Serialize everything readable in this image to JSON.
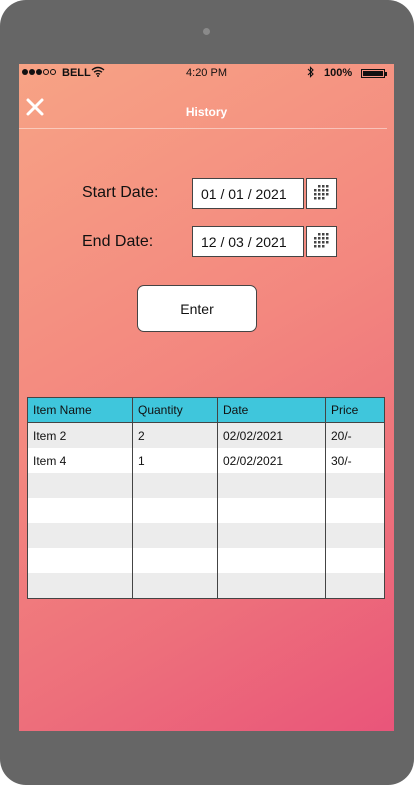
{
  "status_bar": {
    "carrier": "BELL",
    "time": "4:20 PM",
    "battery_percent": "100%",
    "battery_level": 1.0
  },
  "header": {
    "title": "History",
    "close_icon": "close-icon"
  },
  "form": {
    "start_label": "Start Date:",
    "start_value": "01 / 01 / 2021",
    "end_label": "End Date:",
    "end_value": "12 / 03 / 2021",
    "calendar_icon": "calendar-icon",
    "enter_label": "Enter"
  },
  "table": {
    "columns": [
      "Item Name",
      "Quantity",
      "Date",
      "Price"
    ],
    "rows": [
      [
        "Item 2",
        "2",
        "02/02/2021",
        "20/-"
      ],
      [
        "Item 4",
        "1",
        "02/02/2021",
        "30/-"
      ],
      [
        "",
        "",
        "",
        ""
      ],
      [
        "",
        "",
        "",
        ""
      ],
      [
        "",
        "",
        "",
        ""
      ],
      [
        "",
        "",
        "",
        ""
      ],
      [
        "",
        "",
        "",
        ""
      ]
    ]
  },
  "colors": {
    "header_cell": "#3fc6dc",
    "device_frame": "#666666",
    "gradient_start": "#f7a385",
    "gradient_end": "#e9557a"
  }
}
